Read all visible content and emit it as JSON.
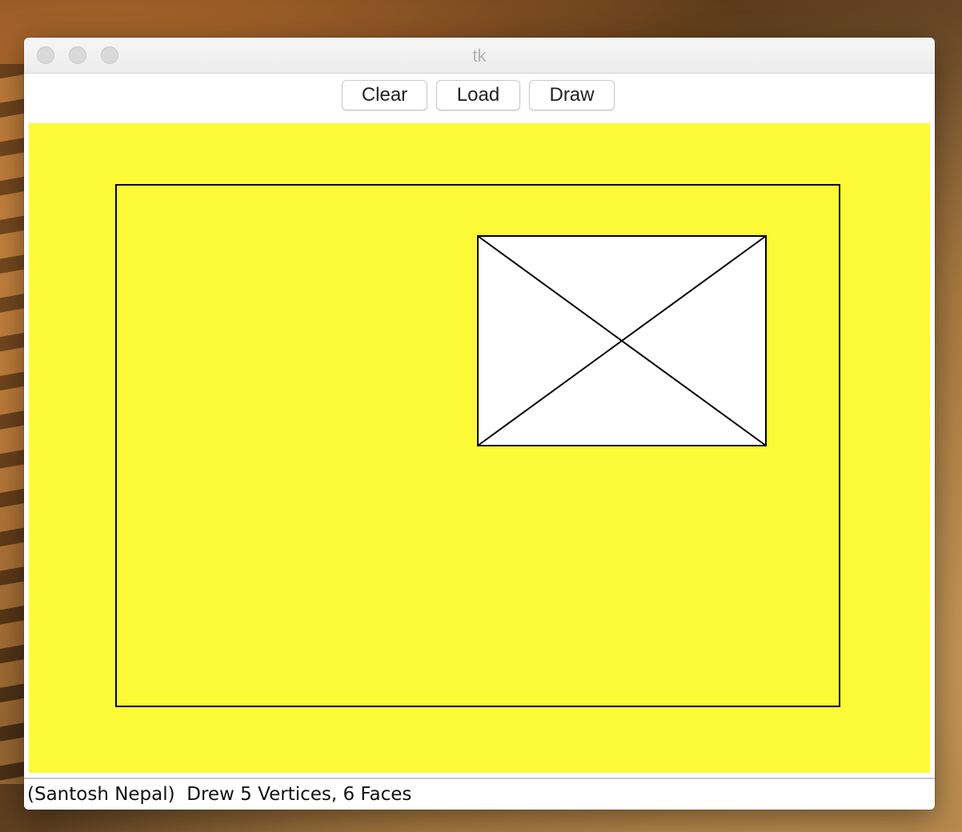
{
  "window": {
    "title": "tk"
  },
  "toolbar": {
    "clear_label": "Clear",
    "load_label": "Load",
    "draw_label": "Draw"
  },
  "canvas": {
    "background": "#fcfa37",
    "stroke": "#000000",
    "vertices_drawn": 5,
    "faces_drawn": 6
  },
  "status": {
    "text": "(Santosh Nepal)  Drew 5 Vertices, 6 Faces"
  },
  "colors": {
    "canvas_bg": "#fcfa37",
    "inner_fill": "#ffffff",
    "window_bg": "#ffffff"
  }
}
